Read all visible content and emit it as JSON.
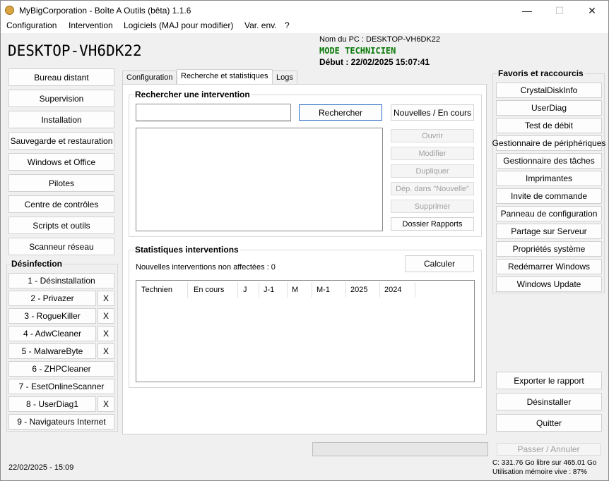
{
  "window": {
    "title": "MyBigCorporation - Boîte A Outils (bêta) 1.1.6",
    "minimize": "—",
    "maximize": "☐",
    "close": "✕"
  },
  "menu": [
    "Configuration",
    "Intervention",
    "Logiciels (MAJ pour modifier)",
    "Var. env.",
    "?"
  ],
  "header": {
    "pc_name_big": "DESKTOP-VH6DK22",
    "pc_name_label": "Nom du PC : DESKTOP-VH6DK22",
    "mode": "MODE TECHNICIEN",
    "start": "Début : 22/02/2025 15:07:41",
    "mode_color": "#0a7a0a"
  },
  "left_nav": [
    "Bureau distant",
    "Supervision",
    "Installation",
    "Sauvegarde et restauration",
    "Windows et Office",
    "Pilotes",
    "Centre de contrôles",
    "Scripts et outils",
    "Scanneur réseau"
  ],
  "desinfection": {
    "title": "Désinfection",
    "items": [
      {
        "label": "1 - Désinstallation",
        "x": ""
      },
      {
        "label": "2 - Privazer",
        "x": "X"
      },
      {
        "label": "3 - RogueKiller",
        "x": "X"
      },
      {
        "label": "4 - AdwCleaner",
        "x": "X"
      },
      {
        "label": "5 - MalwareByte",
        "x": "X"
      },
      {
        "label": "6 - ZHPCleaner",
        "x": ""
      },
      {
        "label": "7 - EsetOnlineScanner",
        "x": ""
      },
      {
        "label": "8 - UserDiag1",
        "x": "X"
      },
      {
        "label": "9 - Navigateurs Internet",
        "x": ""
      }
    ]
  },
  "tabs": [
    "Configuration",
    "Recherche et statistiques",
    "Logs"
  ],
  "search": {
    "title": "Rechercher une intervention",
    "input_value": "",
    "search_button": "Rechercher",
    "new_button": "Nouvelles / En cours",
    "actions": [
      {
        "label": "Ouvrir",
        "enabled": false
      },
      {
        "label": "Modifier",
        "enabled": false
      },
      {
        "label": "Dupliquer",
        "enabled": false
      },
      {
        "label": "Dép. dans \"Nouvelle\"",
        "enabled": false
      },
      {
        "label": "Supprimer",
        "enabled": false
      },
      {
        "label": "Dossier Rapports",
        "enabled": true
      }
    ]
  },
  "stats": {
    "title": "Statistiques interventions",
    "unassigned": "Nouvelles interventions non affectées : 0",
    "compute_button": "Calculer",
    "columns": [
      "Technien",
      "En cours",
      "J",
      "J-1",
      "M",
      "M-1",
      "2025",
      "2024"
    ]
  },
  "favorites": {
    "title": "Favoris et raccourcis",
    "items": [
      "CrystalDiskInfo",
      "UserDiag",
      "Test de débit",
      "Gestionnaire de périphériques",
      "Gestionnaire des tâches",
      "Imprimantes",
      "Invite de commande",
      "Panneau de configuration",
      "Partage sur Serveur",
      "Propriétés système",
      "Redémarrer Windows",
      "Windows Update"
    ]
  },
  "bottom_actions": [
    "Exporter le rapport",
    "Désinstaller",
    "Quitter"
  ],
  "footer": {
    "datetime": "22/02/2025 - 15:09",
    "cancel_button": "Passer / Annuler",
    "disk": "C: 331.76 Go libre sur 465.01 Go",
    "memory": "Utilisation mémoire vive : 87%"
  }
}
